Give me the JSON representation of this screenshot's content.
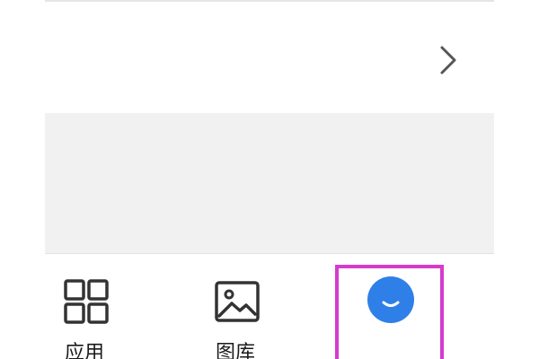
{
  "bottom_nav": {
    "tabs": [
      {
        "label": "应用",
        "icon": "grid-icon"
      },
      {
        "label": "图库",
        "icon": "image-icon"
      },
      {
        "label": "",
        "icon": "smiley-assistant-icon"
      }
    ]
  },
  "row": {
    "chevron_icon": "chevron-right-icon"
  },
  "colors": {
    "highlight_border": "#d63bcc",
    "assistant_blue": "#2f7fe8",
    "gray_background": "#f1f1f1",
    "icon_dark": "#333333"
  }
}
